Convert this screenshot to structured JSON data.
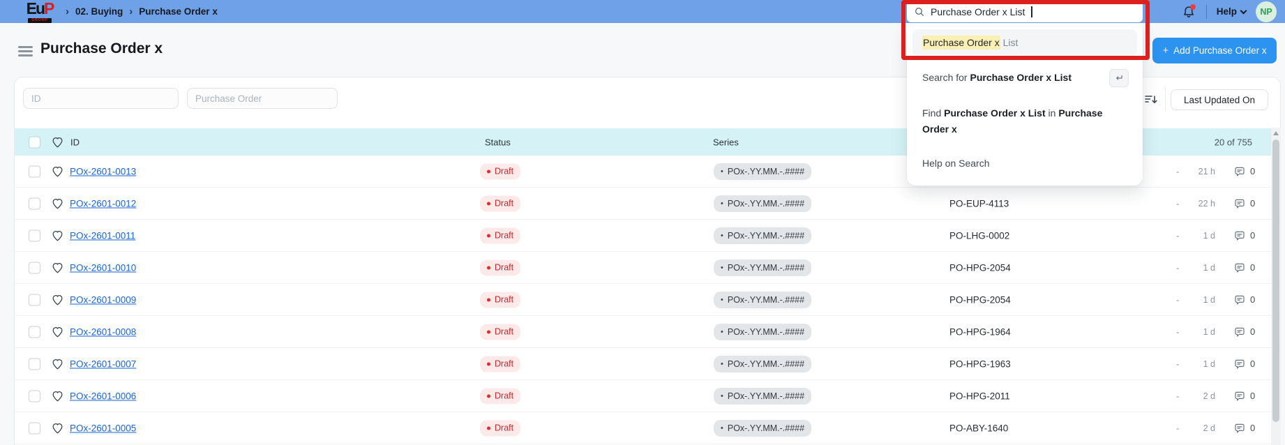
{
  "colors": {
    "navbar": "#6FA1E9",
    "accent": "#2C93F0",
    "link": "#1765D8",
    "header-cyan": "#D5F3F6",
    "draft-bg": "#FCE9E9",
    "draft-text": "#C42B2B",
    "series-bg": "#E3E6E9",
    "highlight-yellow": "#FBF0B4",
    "annotation-red": "#DC1F1F",
    "avatar-bg": "#D9EFDF",
    "avatar-text": "#2F9E55"
  },
  "navbar": {
    "logo_main": "Eu",
    "logo_accent": "P",
    "logo_sub": "GROUP",
    "breadcrumb_sep": "›",
    "breadcrumb": [
      "02. Buying",
      "Purchase Order x"
    ],
    "help_label": "Help",
    "avatar": "NP"
  },
  "search": {
    "value": "Purchase Order x List",
    "suggestion_highlight": "Purchase Order x",
    "suggestion_rest": " List",
    "search_for_prefix": "Search for ",
    "search_for_bold": "Purchase Order x List",
    "find_prefix": "Find ",
    "find_bold": "Purchase Order x List",
    "find_mid": " in ",
    "find_bold2": "Purchase Order x",
    "help_item": "Help on Search"
  },
  "page": {
    "title": "Purchase Order x",
    "add_plus": "+",
    "add_label": "Add Purchase Order x"
  },
  "filters": {
    "id_placeholder": "ID",
    "po_placeholder": "Purchase Order",
    "sort_label": "Last Updated On"
  },
  "table": {
    "headers": {
      "id": "ID",
      "status": "Status",
      "series": "Series"
    },
    "count": "20 of 755",
    "rows": [
      {
        "id": "POx-2601-0013",
        "status": "Draft",
        "series": "POx-.YY.MM.-.####",
        "po": "",
        "dash": "-",
        "time": "21 h",
        "comments": "0"
      },
      {
        "id": "POx-2601-0012",
        "status": "Draft",
        "series": "POx-.YY.MM.-.####",
        "po": "PO-EUP-4113",
        "dash": "-",
        "time": "22 h",
        "comments": "0"
      },
      {
        "id": "POx-2601-0011",
        "status": "Draft",
        "series": "POx-.YY.MM.-.####",
        "po": "PO-LHG-0002",
        "dash": "-",
        "time": "1 d",
        "comments": "0"
      },
      {
        "id": "POx-2601-0010",
        "status": "Draft",
        "series": "POx-.YY.MM.-.####",
        "po": "PO-HPG-2054",
        "dash": "-",
        "time": "1 d",
        "comments": "0"
      },
      {
        "id": "POx-2601-0009",
        "status": "Draft",
        "series": "POx-.YY.MM.-.####",
        "po": "PO-HPG-2054",
        "dash": "-",
        "time": "1 d",
        "comments": "0"
      },
      {
        "id": "POx-2601-0008",
        "status": "Draft",
        "series": "POx-.YY.MM.-.####",
        "po": "PO-HPG-1964",
        "dash": "-",
        "time": "1 d",
        "comments": "0"
      },
      {
        "id": "POx-2601-0007",
        "status": "Draft",
        "series": "POx-.YY.MM.-.####",
        "po": "PO-HPG-1963",
        "dash": "-",
        "time": "1 d",
        "comments": "0"
      },
      {
        "id": "POx-2601-0006",
        "status": "Draft",
        "series": "POx-.YY.MM.-.####",
        "po": "PO-HPG-2011",
        "dash": "-",
        "time": "2 d",
        "comments": "0"
      },
      {
        "id": "POx-2601-0005",
        "status": "Draft",
        "series": "POx-.YY.MM.-.####",
        "po": "PO-ABY-1640",
        "dash": "-",
        "time": "2 d",
        "comments": "0"
      }
    ]
  }
}
